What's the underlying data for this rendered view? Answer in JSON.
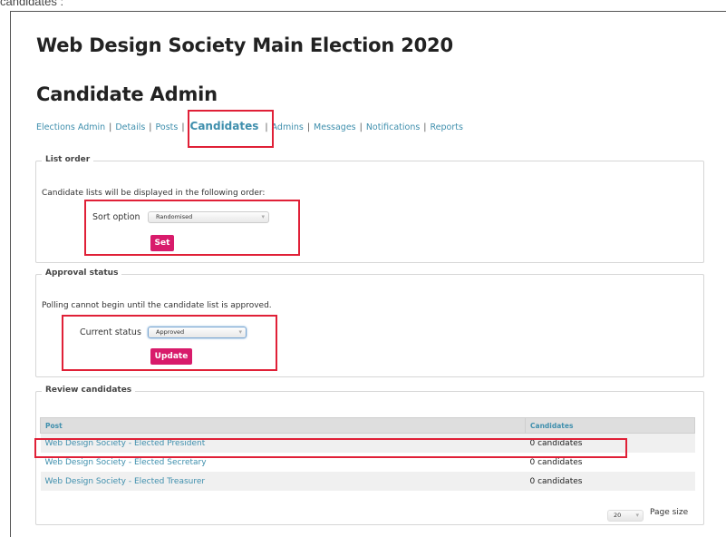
{
  "top_cut_text": "candidates :",
  "page": {
    "title": "Web Design Society Main Election 2020",
    "subtitle": "Candidate Admin"
  },
  "nav": {
    "items": [
      "Elections Admin",
      "Details",
      "Posts",
      "Candidates",
      "Admins",
      "Messages",
      "Notifications",
      "Reports"
    ],
    "active": "Candidates"
  },
  "list_order": {
    "legend": "List order",
    "description": "Candidate lists will be displayed in the following order:",
    "sort_label": "Sort option",
    "sort_value": "Randomised",
    "set_button": "Set"
  },
  "approval_status": {
    "legend": "Approval status",
    "description": "Polling cannot begin until the candidate list is approved.",
    "status_label": "Current status",
    "status_value": "Approved",
    "update_button": "Update"
  },
  "review": {
    "legend": "Review candidates",
    "columns": [
      "Post",
      "Candidates"
    ],
    "rows": [
      {
        "post": "Web Design Society - Elected President",
        "candidates": "0 candidates"
      },
      {
        "post": "Web Design Society - Elected Secretary",
        "candidates": "0 candidates"
      },
      {
        "post": "Web Design Society - Elected Treasurer",
        "candidates": "0 candidates"
      }
    ],
    "page_size_value": "20",
    "page_size_label": "Page size"
  },
  "colors": {
    "accent": "#3f8fad",
    "button": "#d81b6b",
    "highlight_box": "#e02037"
  }
}
